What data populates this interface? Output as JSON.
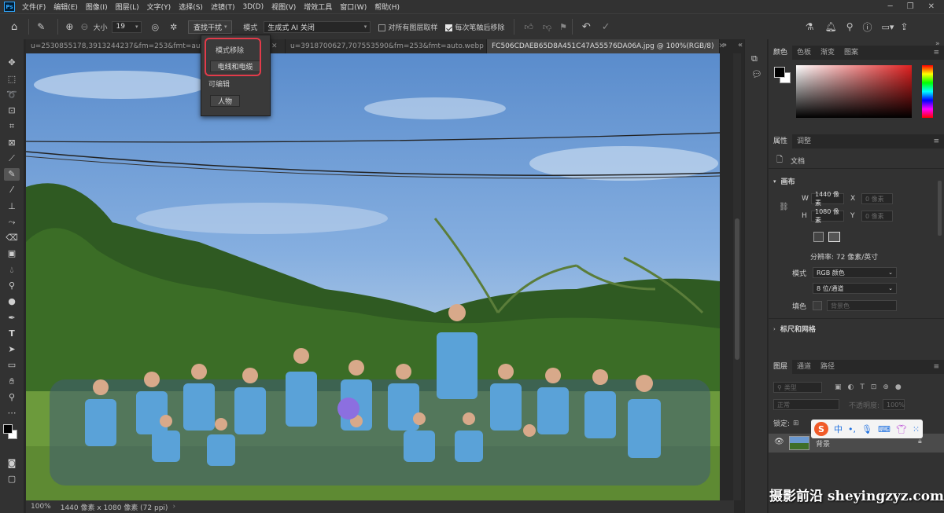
{
  "menubar": {
    "logo": "Ps",
    "items": [
      "文件(F)",
      "编辑(E)",
      "图像(I)",
      "图层(L)",
      "文字(Y)",
      "选择(S)",
      "滤镜(T)",
      "3D(D)",
      "视图(V)",
      "增效工具",
      "窗口(W)",
      "帮助(H)"
    ]
  },
  "options": {
    "size_label": "大小",
    "size_value": "19",
    "find_button": "查找干扰",
    "mode_label": "模式",
    "mode_value": "生成式 AI 关闭",
    "sample_all_label": "对所有图层取样",
    "remove_each_stroke_label": "每次笔触后移除"
  },
  "tabs": [
    {
      "label": "u=2530855178,3913244237&fm=253&fmt=auto...webp",
      "active": false
    },
    {
      "label": "u=3918700627,707553590&fm=253&fmt=auto.webp",
      "active": false
    },
    {
      "label": "FC506CDAEB65D8A451C47A55576DA06A.jpg @ 100%(RGB/8)",
      "active": true
    }
  ],
  "popup": {
    "section1": "模式移除",
    "option1": "电线和电缆",
    "section2": "可编辑",
    "option2": "人物"
  },
  "status": {
    "zoom": "100%",
    "doc_info": "1440 像素 x 1080 像素 (72 ppi)"
  },
  "color_panel": {
    "tabs": [
      "颜色",
      "色板",
      "渐变",
      "图案"
    ],
    "accent": "#e02020"
  },
  "properties": {
    "tabs": [
      "属性",
      "调整"
    ],
    "doc_label": "文档",
    "canvas_title": "画布",
    "w_label": "W",
    "w_value": "1440 像素",
    "h_label": "H",
    "h_value": "1080 像素",
    "x_label": "X",
    "x_placeholder": "0 像素",
    "y_label": "Y",
    "y_placeholder": "0 像素",
    "resolution": "分辨率: 72 像素/英寸",
    "mode_label": "模式",
    "mode_value": "RGB 颜色",
    "depth_value": "8 位/通道",
    "fill_label": "填色",
    "fill_value": "背景色",
    "rulers_title": "标尺和网格"
  },
  "layers": {
    "tabs": [
      "图层",
      "通道",
      "路径"
    ],
    "search_placeholder": "类型",
    "blend_mode": "正常",
    "opacity_label": "不透明度:",
    "opacity_value": "100%",
    "lock_label": "锁定:",
    "layer_name": "背景"
  },
  "ime": {
    "logo": "S",
    "lang": "中"
  },
  "watermark": "摄影前沿 sheyingzyz.com"
}
